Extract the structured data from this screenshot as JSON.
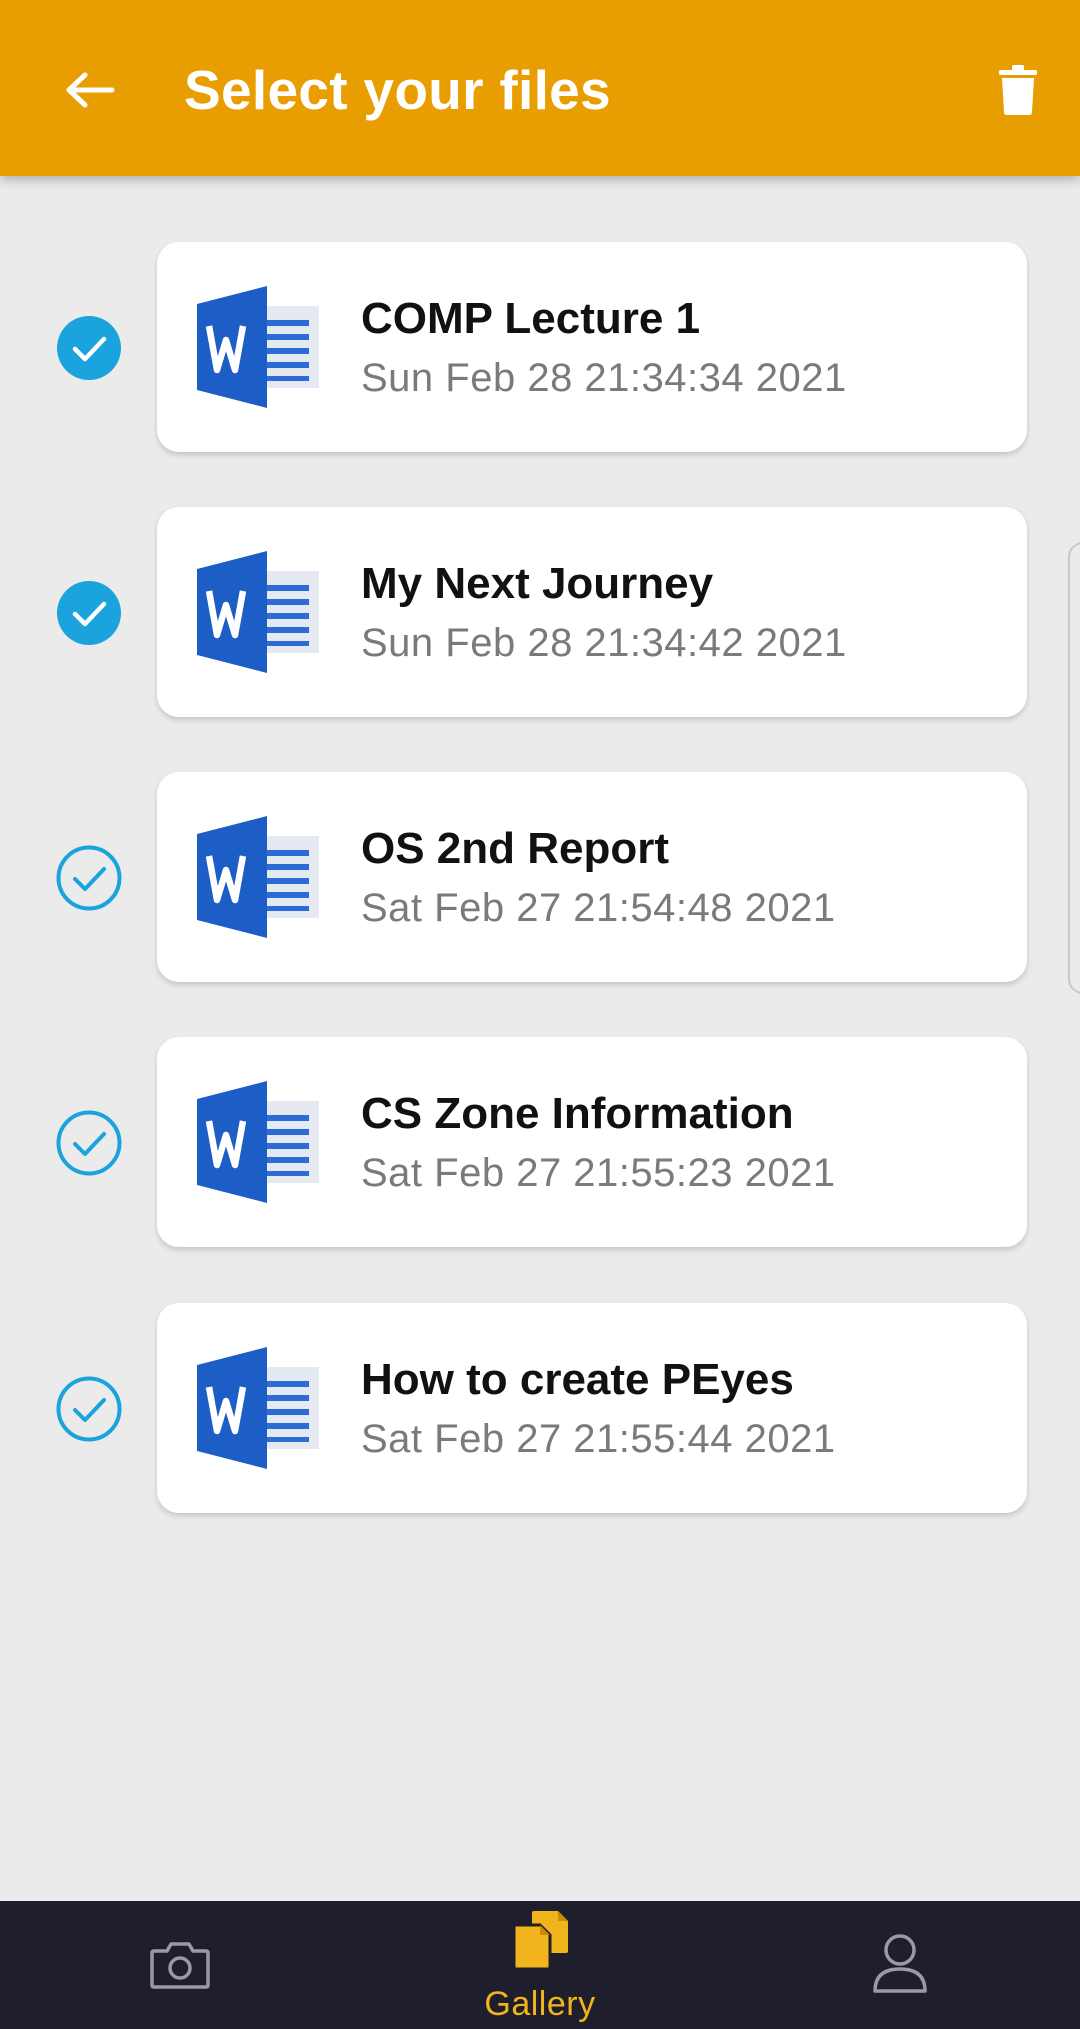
{
  "header": {
    "title": "Select your files",
    "back_icon": "arrow-left-icon",
    "delete_icon": "trash-icon",
    "background": "#e89d00"
  },
  "files": [
    {
      "name": "COMP Lecture 1",
      "date": "Sun Feb 28 21:34:34 2021",
      "selected": true,
      "icon": "word-document-icon"
    },
    {
      "name": "My Next Journey",
      "date": "Sun Feb 28 21:34:42 2021",
      "selected": true,
      "icon": "word-document-icon"
    },
    {
      "name": "OS 2nd Report",
      "date": "Sat Feb 27 21:54:48 2021",
      "selected": false,
      "icon": "word-document-icon"
    },
    {
      "name": "CS Zone Information",
      "date": "Sat Feb 27 21:55:23 2021",
      "selected": false,
      "icon": "word-document-icon"
    },
    {
      "name": "How to create PEyes",
      "date": "Sat Feb 27 21:55:44 2021",
      "selected": false,
      "icon": "word-document-icon"
    }
  ],
  "bottom_nav": {
    "items": [
      {
        "icon": "camera-icon",
        "label": "",
        "active": false
      },
      {
        "icon": "gallery-files-icon",
        "label": "Gallery",
        "active": true
      },
      {
        "icon": "user-profile-icon",
        "label": "",
        "active": false
      }
    ]
  },
  "colors": {
    "accent": "#e89d00",
    "check": "#1aa3dc",
    "nav_active": "#f2b41c",
    "nav_inactive": "#9a9aa2"
  }
}
